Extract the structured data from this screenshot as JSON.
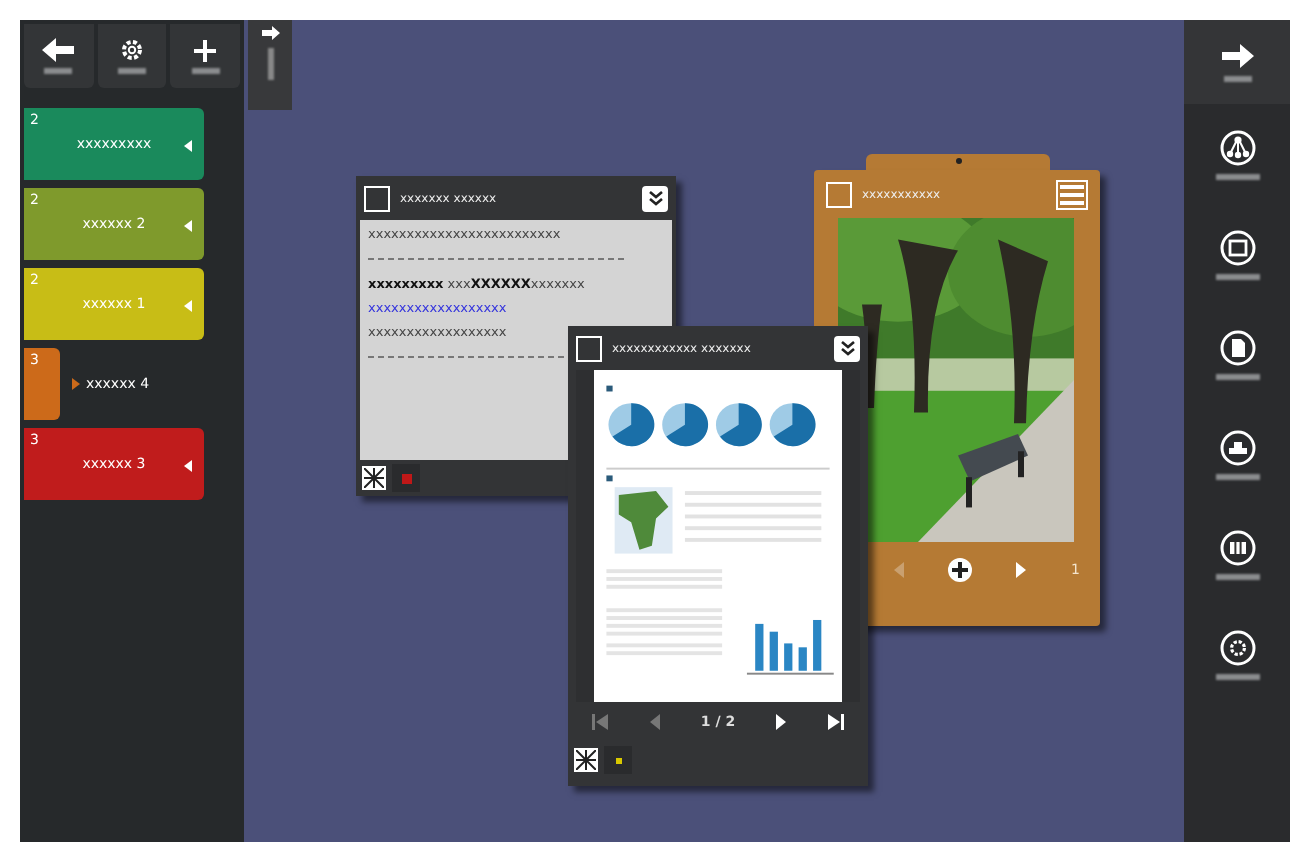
{
  "cards": [
    {
      "number": "2",
      "title": "xxxxxxxxx",
      "color": "#1a8a5c",
      "expanded": true
    },
    {
      "number": "2",
      "title": "xxxxxx 2",
      "color": "#7f9a2c",
      "expanded": true
    },
    {
      "number": "2",
      "title": "xxxxxx 1",
      "color": "#c8bd16",
      "expanded": true
    },
    {
      "number": "3",
      "title": "xxxxxx 4",
      "color": "#cc6a1a",
      "expanded": false
    },
    {
      "number": "3",
      "title": "xxxxxx 3",
      "color": "#c01c1c",
      "expanded": true
    }
  ],
  "note_window": {
    "title": "xxxxxxx xxxxxx",
    "lines": [
      {
        "kind": "text",
        "text": "xxxxxxxxxxxxxxxxxxxxxxxxx"
      },
      {
        "kind": "rule"
      },
      {
        "kind": "text",
        "text": "**xxxxxxxxx** xxx**XXXXXX**xxxxxxx"
      },
      {
        "kind": "link",
        "text": "xxxxxxxxxxxxxxxxxx"
      },
      {
        "kind": "text",
        "text": "xxxxxxxxxxxxxxxxxx"
      },
      {
        "kind": "rule"
      }
    ],
    "color": "#c01818",
    "checked": false
  },
  "document_window": {
    "title": "xxxxxxxxxxxx xxxxxxx",
    "page": "1 / 2",
    "color": "#d8c800",
    "checked": false
  },
  "photo_card": {
    "title": "xxxxxxxxxxx",
    "page": "1",
    "checked": false
  }
}
